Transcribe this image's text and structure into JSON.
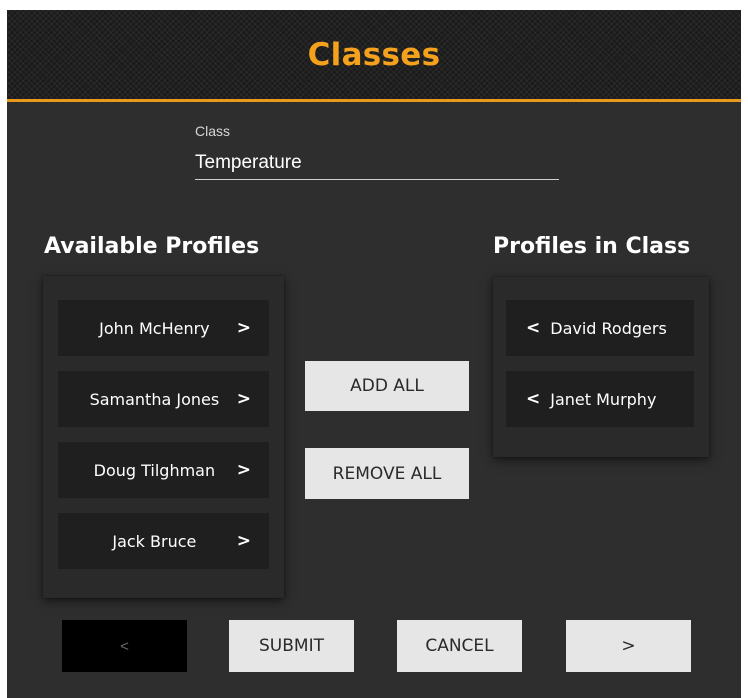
{
  "header": {
    "title": "Classes"
  },
  "class_field": {
    "label": "Class",
    "value": "Temperature"
  },
  "available": {
    "heading": "Available Profiles",
    "items": [
      {
        "name": "John McHenry",
        "chevron": ">"
      },
      {
        "name": "Samantha Jones",
        "chevron": ">"
      },
      {
        "name": "Doug Tilghman",
        "chevron": ">"
      },
      {
        "name": "Jack Bruce",
        "chevron": ">"
      }
    ]
  },
  "in_class": {
    "heading": "Profiles in Class",
    "items": [
      {
        "name": "David Rodgers",
        "chevron": "<"
      },
      {
        "name": "Janet Murphy",
        "chevron": "<"
      }
    ]
  },
  "actions": {
    "add_all": "ADD ALL",
    "remove_all": "REMOVE ALL"
  },
  "footer": {
    "prev": "<",
    "submit": "SUBMIT",
    "cancel": "CANCEL",
    "next": ">"
  },
  "colors": {
    "accent": "#f4a11d",
    "background": "#2e2e2e",
    "item_bg": "#1f1f1f",
    "button_bg": "#e6e6e6"
  }
}
